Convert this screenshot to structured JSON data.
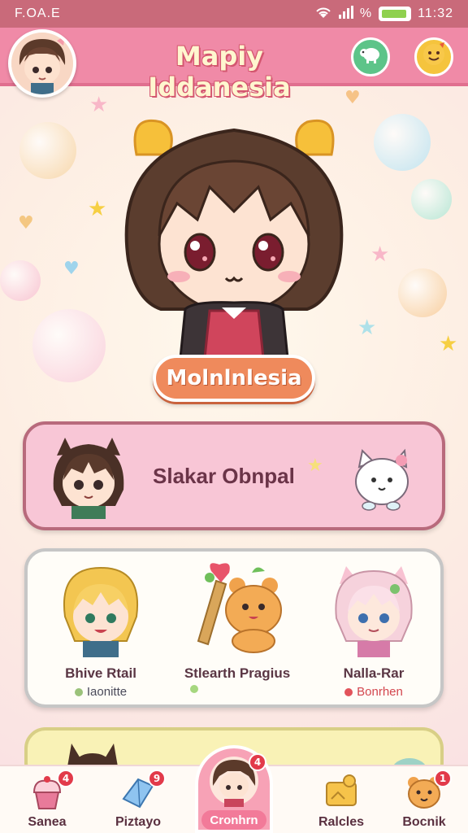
{
  "status_bar": {
    "carrier": "F.OA.E",
    "battery_label": "%",
    "time": "11:32"
  },
  "header": {
    "title": "Mapiy Iddanesia",
    "left_icon": "user-avatar",
    "right_buttons": [
      {
        "icon": "sheep-icon",
        "color": "#5dc489"
      },
      {
        "icon": "smiley-icon",
        "color": "#f5c43d"
      }
    ]
  },
  "hero": {
    "character_name": "Molnlnlesia"
  },
  "profile_card": {
    "name": "Slakar Obnpal"
  },
  "friends": [
    {
      "name": "Bhive Rtail",
      "status": "Iaonitte",
      "status_color": "#9bc27a"
    },
    {
      "name": "Stlearth Pragius",
      "status": "",
      "status_color": "#a6d77f"
    },
    {
      "name": "Nalla-Rar",
      "status": "Bonrhen",
      "status_color": "#e2535b"
    }
  ],
  "bottom_nav": [
    {
      "label": "Sanea",
      "icon": "cupcake-icon",
      "badge": "4"
    },
    {
      "label": "Piztayo",
      "icon": "crystal-icon",
      "badge": "9"
    },
    {
      "label": "Cronhrn",
      "icon": "avatar-icon",
      "badge": "4"
    },
    {
      "label": "Ralcles",
      "icon": "card-icon",
      "badge": ""
    },
    {
      "label": "Bocnik",
      "icon": "bear-icon",
      "badge": "1"
    }
  ]
}
